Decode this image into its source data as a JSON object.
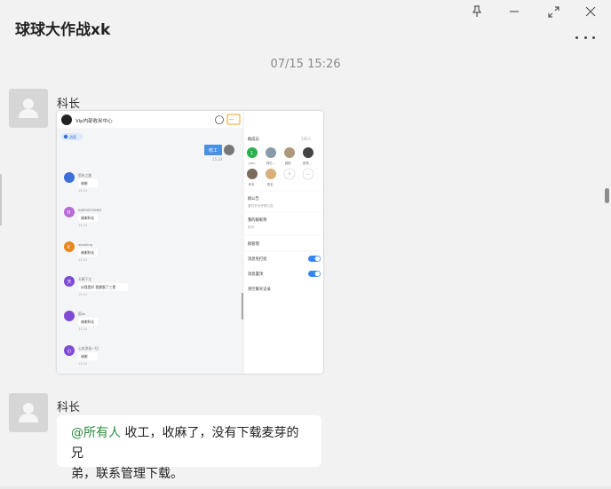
{
  "window": {
    "title": "球球大作战xk",
    "controls": [
      "pin-icon",
      "minimize-icon",
      "maximize-icon",
      "close-icon"
    ]
  },
  "chat": {
    "timestamp": "07/15 15:26",
    "messages": [
      {
        "sender": "科长",
        "type": "image"
      },
      {
        "sender": "科长",
        "type": "text",
        "mention": "@所有人",
        "text_line1": " 收工，收麻了，没有下载麦芽的兄",
        "text_line2": "弟，联系管理下载。"
      }
    ]
  },
  "screenshot": {
    "title": "Vip内部收米中心",
    "chip": "消息",
    "my_msg": "收工",
    "my_time": "15:24",
    "msgs": [
      {
        "initial": "",
        "color": "#3f6fd6",
        "name": "国米之路",
        "text": "谢谢",
        "time": "15:24"
      },
      {
        "initial": "H",
        "color": "#b86ad6",
        "name": "KJ6940559ND",
        "text": "谢谢科长",
        "time": "15:24"
      },
      {
        "initial": "X",
        "color": "#e8891f",
        "name": "xiaoking",
        "text": "谢谢科长",
        "time": "15:24"
      },
      {
        "initial": "天",
        "color": "#7e4cd4",
        "name": "天赐下注",
        "text": "@我是好 我都脱了三把",
        "time": "15:24"
      },
      {
        "initial": "",
        "color": "#7e4cd4",
        "name": "国ok",
        "text": "谢谢科长",
        "time": "15:24"
      },
      {
        "initial": "心",
        "color": "#7e4cd4",
        "name": "心态净选一切",
        "text": "谢谢",
        "time": "15:24"
      }
    ],
    "right": {
      "members_label": "群成员",
      "members_count": "245人",
      "members": [
        "yuru",
        "阿亿...",
        "欧阳",
        "彭燕..."
      ],
      "members2": [
        "科长",
        "陈名"
      ],
      "notice_label": "群公告",
      "notice_text": "暂时不允许群公告",
      "nickname_label": "我的群昵称",
      "nickname_value": "科长",
      "manage_label": "群管理",
      "mute_label": "消息免打扰",
      "pin_label": "消息置顶",
      "clear_label": "清空聊天记录",
      "mute_on": true,
      "pin_on": true
    }
  }
}
